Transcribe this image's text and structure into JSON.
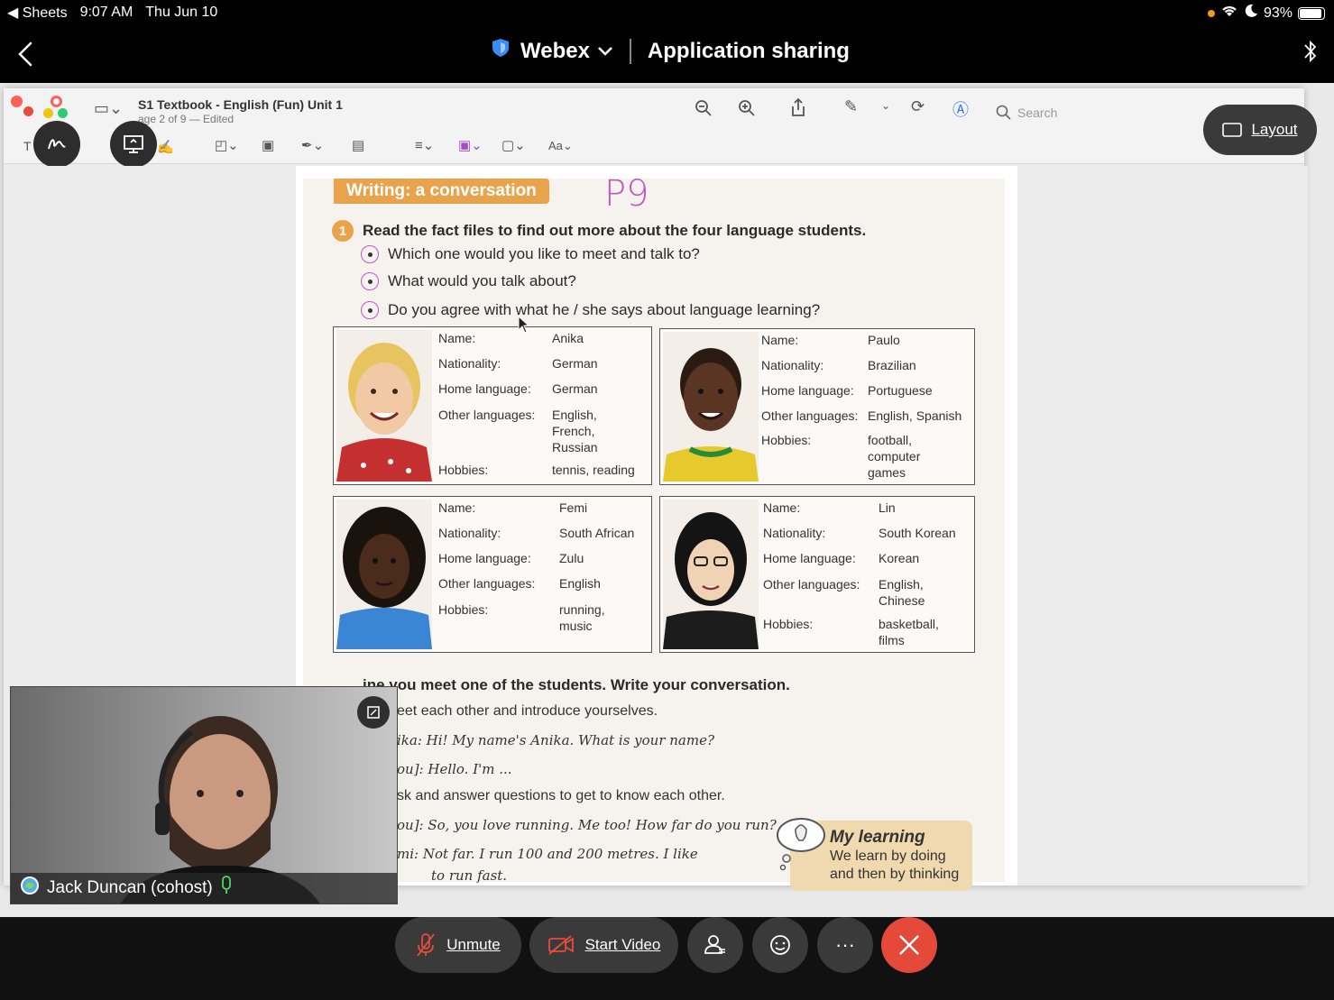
{
  "status_bar": {
    "back_app": "◀ Sheets",
    "time": "9:07 AM",
    "date": "Thu Jun 10",
    "battery": "93%",
    "battery_level": 0.93
  },
  "header": {
    "app_name": "Webex",
    "title": "Application sharing"
  },
  "shared_app": {
    "doc_title": "S1 Textbook - English (Fun) Unit 1",
    "doc_subtitle": "age 2 of 9 — Edited",
    "search_placeholder": "Search",
    "layout_button": "Layout"
  },
  "page": {
    "section_title": "Writing: a conversation",
    "handwritten_note": "P9",
    "q1_number": "1",
    "q1_text": "Read the fact files to find out more about the four language students.",
    "bullets": [
      "Which one would you like to meet and talk to?",
      "What would you talk about?",
      "Do you agree with what he / she says about language learning?"
    ],
    "fact_cards": [
      {
        "rows": [
          {
            "label": "Name:",
            "value": "Anika"
          },
          {
            "label": "Nationality:",
            "value": "German"
          },
          {
            "label": "Home language:",
            "value": "German"
          },
          {
            "label": "Other languages:",
            "value": "English,\nFrench,\nRussian"
          },
          {
            "label": "Hobbies:",
            "value": "tennis, reading"
          }
        ]
      },
      {
        "rows": [
          {
            "label": "Name:",
            "value": "Paulo"
          },
          {
            "label": "Nationality:",
            "value": "Brazilian"
          },
          {
            "label": "Home language:",
            "value": "Portuguese"
          },
          {
            "label": "Other languages:",
            "value": "English, Spanish"
          },
          {
            "label": "Hobbies:",
            "value": "football,\ncomputer\ngames"
          }
        ]
      },
      {
        "rows": [
          {
            "label": "Name:",
            "value": "Femi"
          },
          {
            "label": "Nationality:",
            "value": "South African"
          },
          {
            "label": "Home language:",
            "value": "Zulu"
          },
          {
            "label": "Other languages:",
            "value": "English"
          },
          {
            "label": "Hobbies:",
            "value": "running,\nmusic"
          }
        ]
      },
      {
        "rows": [
          {
            "label": "Name:",
            "value": "Lin"
          },
          {
            "label": "Nationality:",
            "value": "South Korean"
          },
          {
            "label": "Home language:",
            "value": "Korean"
          },
          {
            "label": "Other languages:",
            "value": "English,\nChinese"
          },
          {
            "label": "Hobbies:",
            "value": "basketball,\nfilms"
          }
        ]
      }
    ],
    "q2_text": "ine you meet one of the students. Write your conversation.",
    "q2_lines": [
      {
        "text": "eet each other and introduce yourselves.",
        "style": "normal"
      },
      {
        "text": "ika: Hi! My name's Anika. What is your name?",
        "style": "hand"
      },
      {
        "text": "ou]: Hello. I'm ...",
        "style": "hand"
      },
      {
        "text": "sk and answer questions to get to know each other.",
        "style": "normal"
      },
      {
        "text": "ou]: So, you love running. Me too! How far do you run?",
        "style": "hand"
      },
      {
        "text": "mi: Not far. I run 100 and 200 metres. I like",
        "style": "hand"
      },
      {
        "text": "to run fast.",
        "style": "hand"
      }
    ],
    "my_learning_title": "My learning",
    "my_learning_text": "We learn by doing and then by thinking"
  },
  "video": {
    "participant_name": "Jack Duncan (cohost)"
  },
  "controls": {
    "unmute": "Unmute",
    "start_video": "Start Video",
    "more": "···"
  }
}
